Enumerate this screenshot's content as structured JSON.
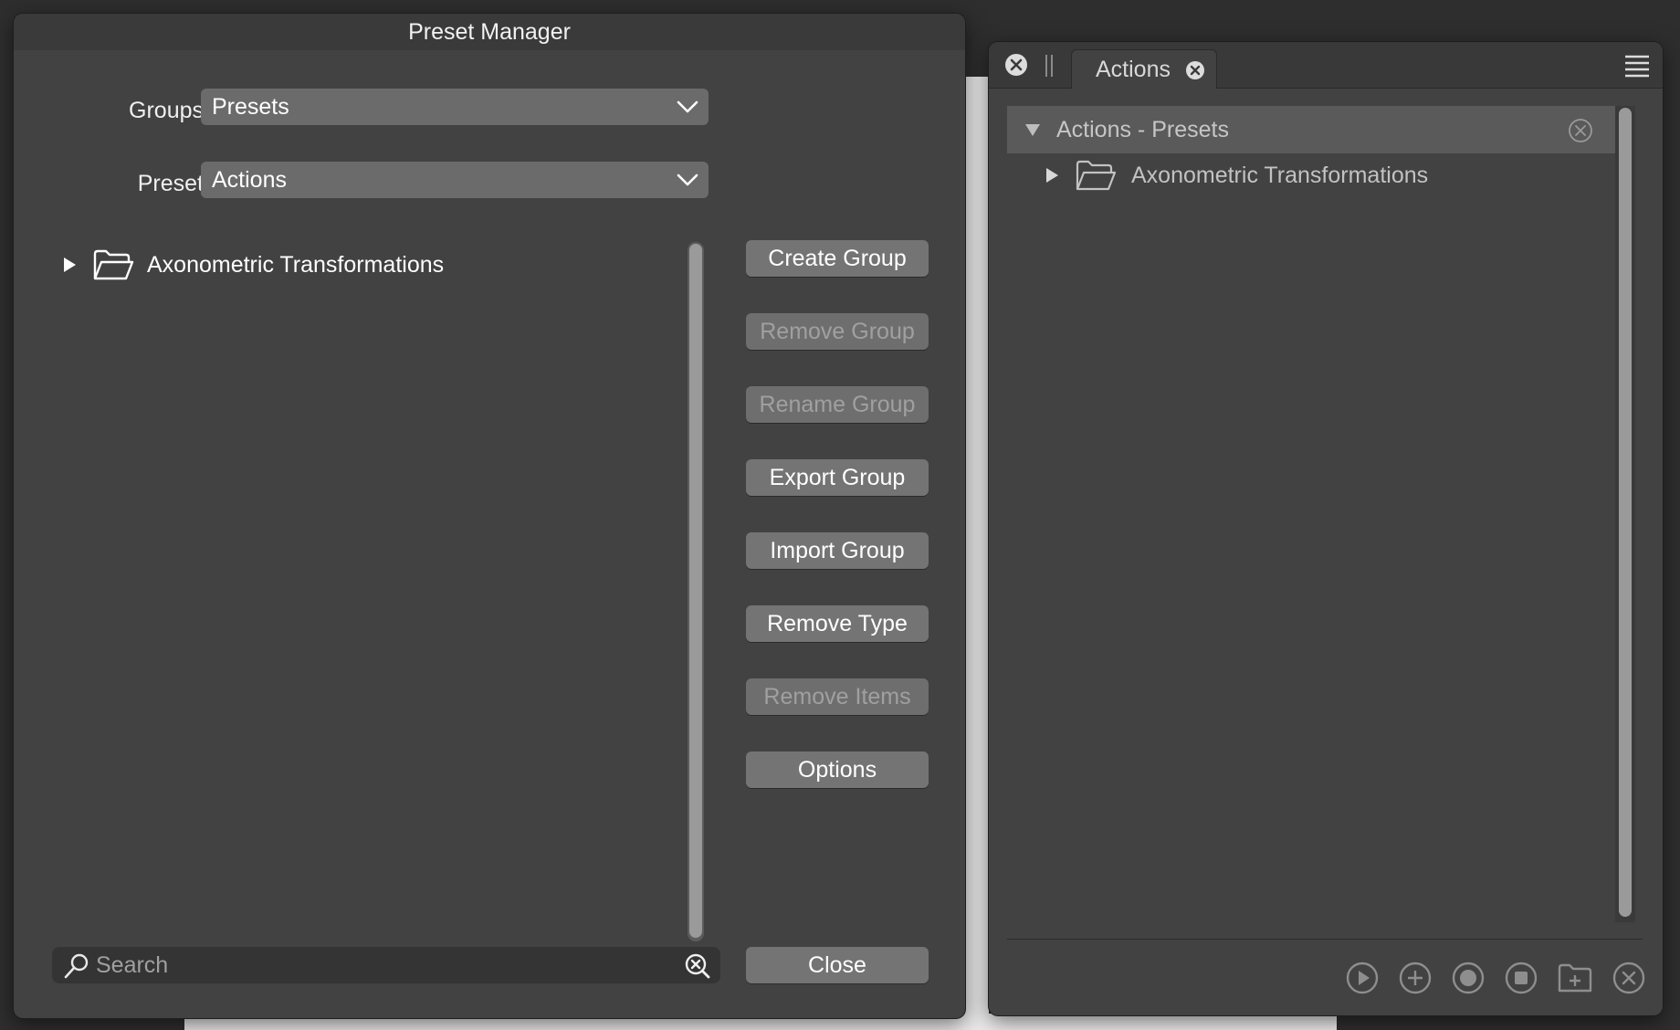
{
  "dialog": {
    "title": "Preset Manager",
    "groups_label": "Groups",
    "groups_value": "Presets",
    "preset_label": "Preset",
    "preset_value": "Actions",
    "tree_item": "Axonometric Transformations",
    "buttons": {
      "create_group": "Create Group",
      "remove_group": "Remove Group",
      "rename_group": "Rename Group",
      "export_group": "Export Group",
      "import_group": "Import Group",
      "remove_type": "Remove Type",
      "remove_items": "Remove Items",
      "options": "Options",
      "close": "Close"
    },
    "search_placeholder": "Search"
  },
  "panel": {
    "tab_label": "Actions",
    "group_header": "Actions - Presets",
    "tree_item": "Axonometric Transformations",
    "toolbar_icons": [
      "play-icon",
      "add-icon",
      "record-icon",
      "stop-icon",
      "new-folder-icon",
      "delete-icon"
    ]
  },
  "colors": {
    "window_bg": "#424242",
    "button_bg": "#747474",
    "disabled_text": "#a0a0a0",
    "select_bg": "#6b6b6b"
  }
}
